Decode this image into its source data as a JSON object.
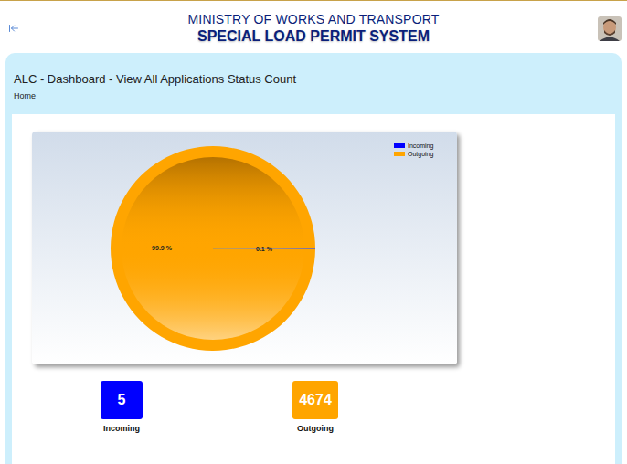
{
  "header": {
    "title": "MINISTRY OF WORKS AND TRANSPORT",
    "subtitle": "SPECIAL LOAD PERMIT SYSTEM"
  },
  "page": {
    "title": "ALC - Dashboard - View All Applications Status Count",
    "breadcrumb": [
      "Home"
    ]
  },
  "chart": {
    "series": [
      {
        "name": "Incoming",
        "values": [
          5
        ],
        "label": "0.1 %",
        "color": "#0000ff"
      },
      {
        "name": "Outgoing",
        "values": [
          4674
        ],
        "label": "99.9 %",
        "color": "#ffa500"
      }
    ]
  },
  "tiles": [
    {
      "label": "Incoming",
      "count": "5",
      "color": "#0000ff"
    },
    {
      "label": "Outgoing",
      "count": "4674",
      "color": "#ffa500"
    }
  ]
}
